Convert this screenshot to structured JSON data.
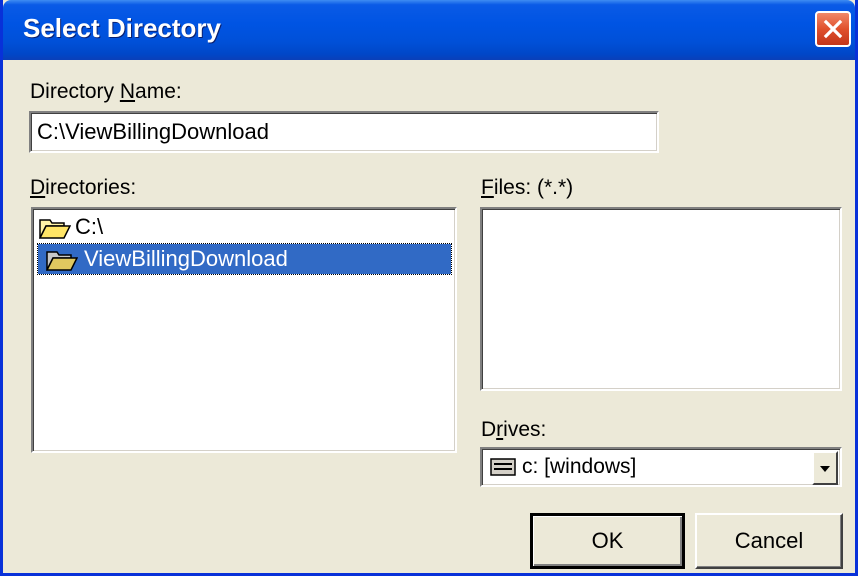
{
  "window": {
    "title": "Select Directory"
  },
  "directory_name": {
    "label_pre": "Directory ",
    "label_mnemonic": "N",
    "label_post": "ame:",
    "value": "C:\\ViewBillingDownload"
  },
  "directories": {
    "label_mnemonic": "D",
    "label_post": "irectories:",
    "items": [
      {
        "label": "C:\\",
        "selected": false
      },
      {
        "label": "ViewBillingDownload",
        "selected": true
      }
    ]
  },
  "files": {
    "label_mnemonic": "F",
    "label_post": "iles: (*.*)",
    "items": []
  },
  "drives": {
    "label_pre": "D",
    "label_mnemonic": "r",
    "label_post": "ives:",
    "selected": "c: [windows]"
  },
  "buttons": {
    "ok": "OK",
    "cancel": "Cancel"
  },
  "colors": {
    "titlebar": "#0054e3",
    "selection": "#316ac5",
    "face": "#ece9d8"
  }
}
